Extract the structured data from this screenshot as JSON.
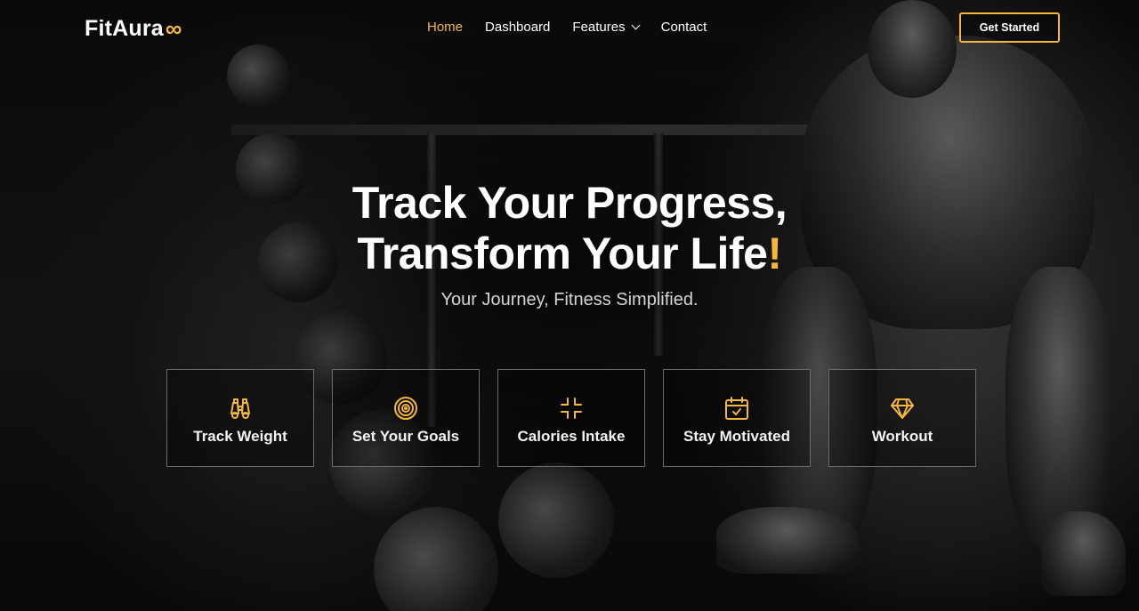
{
  "brand": {
    "name": "FitAura",
    "mark": "∞"
  },
  "nav": {
    "links": [
      {
        "label": "Home",
        "active": true
      },
      {
        "label": "Dashboard"
      },
      {
        "label": "Features",
        "has_dropdown": true
      },
      {
        "label": "Contact"
      }
    ],
    "cta_label": "Get Started"
  },
  "hero": {
    "line1": "Track Your Progress,",
    "line2": "Transform Your Life",
    "line2_accent": "!",
    "subtitle": "Your Journey, Fitness Simplified."
  },
  "features": [
    {
      "label": "Track Weight",
      "icon": "binoculars-icon"
    },
    {
      "label": "Set Your Goals",
      "icon": "target-icon"
    },
    {
      "label": "Calories Intake",
      "icon": "compress-arrows-icon"
    },
    {
      "label": "Stay Motivated",
      "icon": "calendar-check-icon"
    },
    {
      "label": "Workout",
      "icon": "diamond-icon"
    }
  ],
  "colors": {
    "accent": "#f5b83d",
    "background": "#000000"
  }
}
